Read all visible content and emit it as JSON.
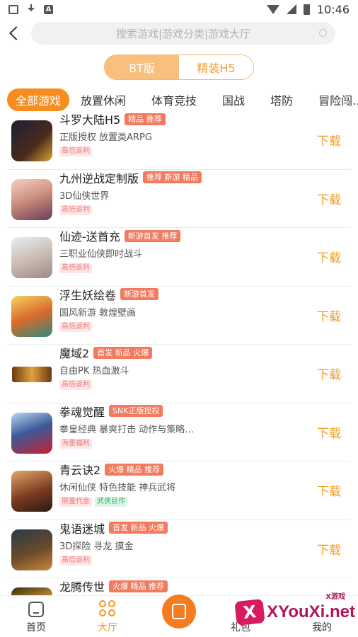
{
  "status_bar": {
    "time": "10:46",
    "a_icon_letter": "A"
  },
  "search": {
    "placeholder": "搜索游戏|游戏分类|游戏大厅"
  },
  "toggle": {
    "bt_label": "BT版",
    "h5_label": "精装H5"
  },
  "categories": [
    "全部游戏",
    "放置休闲",
    "体育竞技",
    "国战",
    "塔防",
    "冒险闯…"
  ],
  "games": [
    {
      "name": "斗罗大陆H5",
      "tags": [
        "精品 推荐"
      ],
      "desc": "正版授权 放置类ARPG",
      "badges": [
        "高倍返利"
      ],
      "download": "下载"
    },
    {
      "name": "九州逆战定制版",
      "tags": [
        "推荐 新游 精品"
      ],
      "desc": "3D仙侠世界",
      "badges": [
        "高倍返利"
      ],
      "download": "下载"
    },
    {
      "name": "仙迹-送首充",
      "tags": [
        "新游首发 推荐"
      ],
      "desc": "三职业仙侠即时战斗",
      "badges": [
        "高倍返利"
      ],
      "download": "下载"
    },
    {
      "name": "浮生妖绘卷",
      "tags": [
        "新游首发"
      ],
      "desc": "国风新游 敦煌壁画",
      "badges": [
        "高倍返利"
      ],
      "download": "下载"
    },
    {
      "name": "魔域2",
      "tags": [
        "首发 新品 火爆"
      ],
      "desc": "自由PK 热血激斗",
      "badges": [
        "高倍返利"
      ],
      "download": "下载"
    },
    {
      "name": "拳魂觉醒",
      "tags": [
        "SNK正版授权"
      ],
      "desc": "拳皇经典 暴爽打击 动作与策略…",
      "badges": [
        "海量福利"
      ],
      "download": "下载"
    },
    {
      "name": "青云诀2",
      "tags": [
        "火爆 精品 推荐"
      ],
      "desc": "休闲仙侠 特色技能 神兵武将",
      "badges": [
        "限量代金",
        "武侠巨作"
      ],
      "download": "下载"
    },
    {
      "name": "鬼语迷城",
      "tags": [
        "首发 新品 火爆"
      ],
      "desc": "3D探险 寻龙 摸金",
      "badges": [
        "高倍返利"
      ],
      "download": "下载"
    },
    {
      "name": "龙腾传世",
      "tags": [
        "火爆 精品 推荐"
      ],
      "desc": "",
      "badges": [],
      "download": ""
    }
  ],
  "nav": {
    "home": "首页",
    "hall": "大厅",
    "gift": "礼包",
    "mine": "我的"
  },
  "watermark": {
    "main": "XYouXi.net",
    "sub": "X游戏",
    "x": "X"
  },
  "colors": {
    "accent": "#f39a1a",
    "tag_bg": "#f27a5e",
    "toggle_active": "#f9bf7d"
  }
}
